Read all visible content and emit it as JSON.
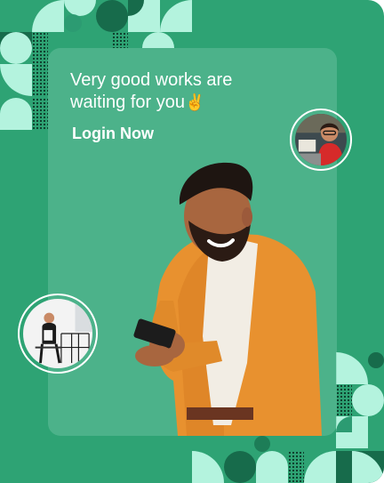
{
  "promo": {
    "headline": "Very good works are waiting for you",
    "headline_emoji": "✌️",
    "login_label": "Login Now"
  },
  "images": {
    "hero": "man-smiling-at-phone-photo",
    "avatar_top": "woman-with-glasses-at-laptop-photo",
    "avatar_left": "businessman-sitting-on-chair-photo"
  },
  "colors": {
    "background": "#2ea374",
    "pattern_dark": "#176b4b",
    "pattern_mint": "#b4f3de",
    "card": "rgba(120,200,170,0.42)",
    "text": "#ffffff",
    "jacket": "#e8912f"
  }
}
